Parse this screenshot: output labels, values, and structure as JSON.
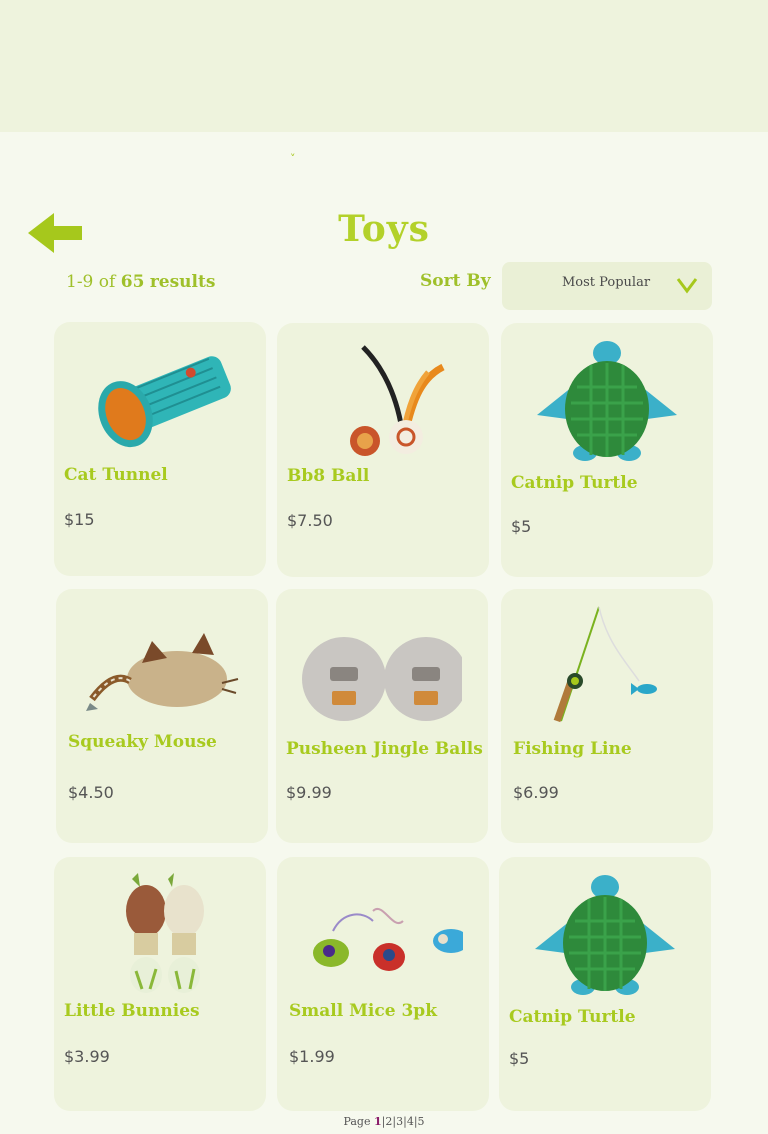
{
  "header": {
    "nav_caret": "˅"
  },
  "page": {
    "title": "Toys",
    "back_icon": "left-arrow-icon"
  },
  "results": {
    "range": "1-9",
    "of_label": "of",
    "total": "65",
    "results_label": "results"
  },
  "sort": {
    "label": "Sort By",
    "selected": "Most Popular"
  },
  "products": [
    {
      "name": "Cat Tunnel",
      "price": "$15"
    },
    {
      "name": "Bb8 Ball",
      "price": "$7.50"
    },
    {
      "name": "Catnip Turtle",
      "price": "$5"
    },
    {
      "name": "Squeaky Mouse",
      "price": "$4.50"
    },
    {
      "name": "Pusheen Jingle Balls",
      "price": "$9.99"
    },
    {
      "name": "Fishing Line",
      "price": "$6.99"
    },
    {
      "name": "Little Bunnies",
      "price": "$3.99"
    },
    {
      "name": "Small Mice 3pk",
      "price": "$1.99"
    },
    {
      "name": "Catnip Turtle",
      "price": "$5"
    }
  ],
  "pagination": {
    "label": "Page",
    "current": "1",
    "pages": [
      "2",
      "3",
      "4",
      "5"
    ],
    "separator": "|"
  },
  "colors": {
    "accent": "#b3d12a",
    "card_bg": "#eef3dd",
    "page_bg": "#f6f9ee",
    "header_bg": "#eef3dd"
  }
}
